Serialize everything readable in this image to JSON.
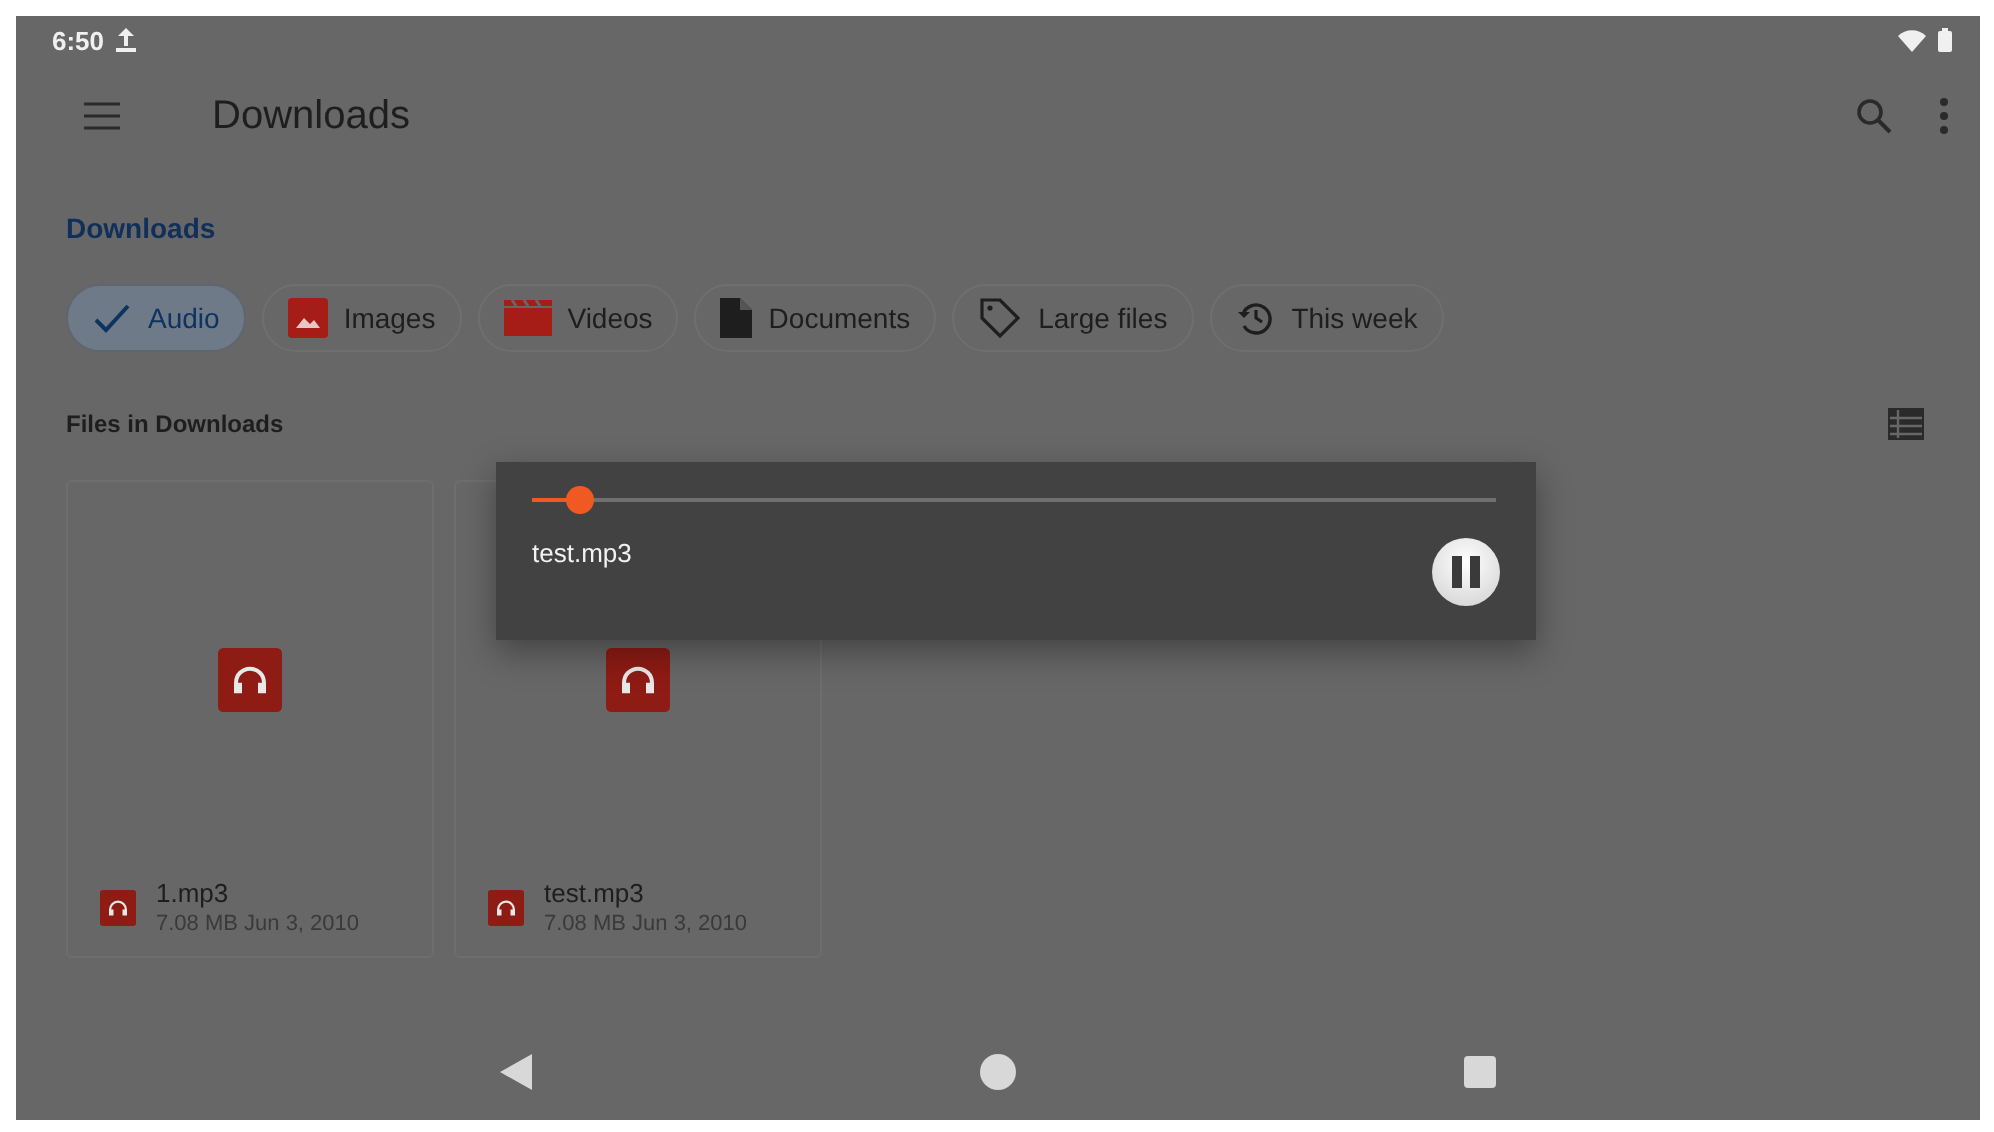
{
  "status_bar": {
    "time": "6:50"
  },
  "toolbar": {
    "title": "Downloads"
  },
  "breadcrumb": [
    "Downloads"
  ],
  "chips": [
    {
      "label": "Audio",
      "selected": true
    },
    {
      "label": "Images",
      "kind": "images",
      "selected": false
    },
    {
      "label": "Videos",
      "kind": "videos",
      "selected": false
    },
    {
      "label": "Documents",
      "kind": "documents",
      "selected": false
    },
    {
      "label": "Large files",
      "kind": "large",
      "selected": false
    },
    {
      "label": "This week",
      "kind": "recent",
      "selected": false
    }
  ],
  "section_title": "Files in Downloads",
  "files": [
    {
      "name": "1.mp3",
      "meta": "7.08 MB Jun 3, 2010"
    },
    {
      "name": "test.mp3",
      "meta": "7.08 MB Jun 3, 2010"
    }
  ],
  "player": {
    "file": "test.mp3",
    "level": 0.05,
    "playing": true
  }
}
